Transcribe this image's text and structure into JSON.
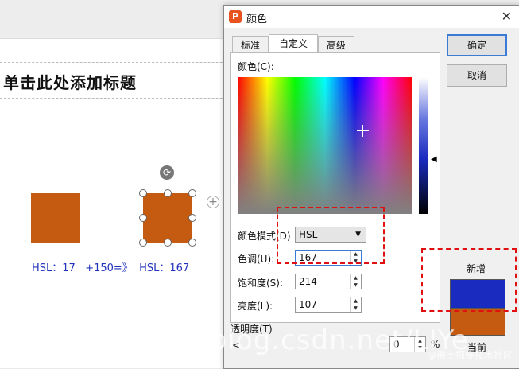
{
  "slide": {
    "title": "单击此处添加标题",
    "caption": "HSL：17   +150=》  HSL：167"
  },
  "dialog": {
    "title": "颜色",
    "close_glyph": "✕",
    "app_icon_glyph": "P",
    "tabs": [
      {
        "label": "标准"
      },
      {
        "label": "自定义"
      },
      {
        "label": "高级"
      }
    ],
    "color_label": "颜色(C):",
    "mode_label": "颜色模式(D)",
    "mode_value": "HSL",
    "hue_label": "色调(U):",
    "hue_value": "167",
    "saturation_label": "饱和度(S):",
    "saturation_value": "214",
    "lightness_label": "亮度(L):",
    "lightness_value": "107",
    "ok_label": "确定",
    "cancel_label": "取消",
    "new_label": "新增",
    "current_label": "当前",
    "transparency_label": "透明度(T)",
    "transparency_value": "0",
    "transparency_unit": "%"
  },
  "colors": {
    "orange": "#c55a11",
    "new_blue": "#1a2bbf",
    "highlight_red": "#e01010"
  },
  "watermark": {
    "url": "https://blog.csdn.net/LIYe",
    "site": "@稀土掘金技术社区"
  }
}
